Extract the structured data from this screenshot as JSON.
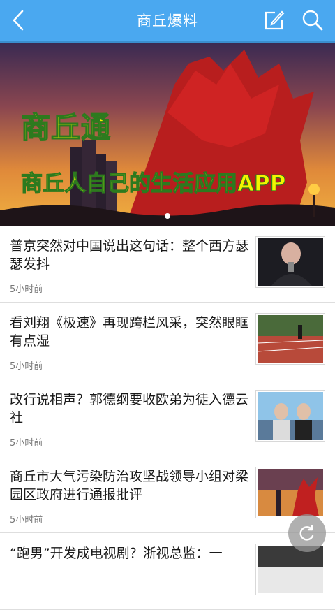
{
  "header": {
    "title": "商丘爆料",
    "back_icon": "chevron-left-icon",
    "edit_icon": "edit-icon",
    "search_icon": "search-icon"
  },
  "banner": {
    "title": "商丘通",
    "subtitle": "商丘人自己的生活应用APP",
    "dots_total": 1,
    "active_dot": 1
  },
  "news": [
    {
      "headline": "普京突然对中国说出这句话：整个西方瑟瑟发抖",
      "time": "5小时前"
    },
    {
      "headline": "看刘翔《极速》再现跨栏风采，突然眼眶有点湿",
      "time": "5小时前"
    },
    {
      "headline": "改行说相声？郭德纲要收欧弟为徒入德云社",
      "time": "5小时前"
    },
    {
      "headline": "商丘市大气污染防治攻坚战领导小组对梁园区政府进行通报批评",
      "time": "5小时前"
    },
    {
      "headline": "“跑男”开发成电视剧？浙视总监：一",
      "time": ""
    }
  ],
  "colors": {
    "header": "#4aa8f0",
    "banner_text": "#f2f500",
    "banner_text_stroke": "#2d7a1e"
  },
  "fab": {
    "icon": "refresh-icon"
  }
}
